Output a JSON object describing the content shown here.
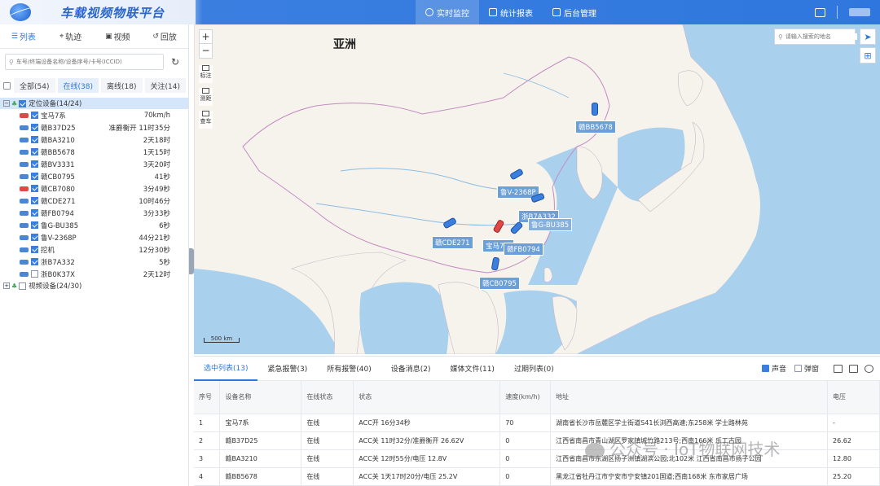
{
  "app": {
    "title": "车载视频物联平台"
  },
  "nav": [
    {
      "label": "实时监控",
      "active": true
    },
    {
      "label": "统计报表",
      "active": false
    },
    {
      "label": "后台管理",
      "active": false
    }
  ],
  "left": {
    "tabs": [
      {
        "icon": "list-icon",
        "label": "列表",
        "active": true
      },
      {
        "icon": "track-icon",
        "label": "轨迹",
        "active": false
      },
      {
        "icon": "video-icon",
        "label": "视频",
        "active": false
      },
      {
        "icon": "playback-icon",
        "label": "回放",
        "active": false
      }
    ],
    "search_placeholder": "车号/终端设备名称/设备序号/卡号(ICCID)",
    "filters": [
      {
        "label": "全部(54)",
        "active": false
      },
      {
        "label": "在线(38)",
        "active": true
      },
      {
        "label": "离线(18)",
        "active": false
      },
      {
        "label": "关注(14)",
        "active": false
      }
    ],
    "group_located": "定位设备(14/24)",
    "group_video": "视频设备(24/30)",
    "vehicles": [
      {
        "plate": "宝马7系",
        "status": "70km/h",
        "red": true,
        "checked": true
      },
      {
        "plate": "赣B37D25",
        "status": "准爵衡开 11时35分",
        "red": false,
        "checked": true
      },
      {
        "plate": "赣BA3210",
        "status": "2天18时",
        "red": false,
        "checked": true
      },
      {
        "plate": "赣BB5678",
        "status": "1天15时",
        "red": false,
        "checked": true
      },
      {
        "plate": "赣BV3331",
        "status": "3天20时",
        "red": false,
        "checked": true
      },
      {
        "plate": "赣CB0795",
        "status": "41秒",
        "red": false,
        "checked": true
      },
      {
        "plate": "赣CB7080",
        "status": "3分49秒",
        "red": true,
        "checked": true
      },
      {
        "plate": "赣CDE271",
        "status": "10时46分",
        "red": false,
        "checked": true
      },
      {
        "plate": "赣FB0794",
        "status": "3分33秒",
        "red": false,
        "checked": true
      },
      {
        "plate": "鲁G-BU385",
        "status": "6秒",
        "red": false,
        "checked": true
      },
      {
        "plate": "鲁V-2368P",
        "status": "44分21秒",
        "red": false,
        "checked": true
      },
      {
        "plate": "挖机",
        "status": "12分30秒",
        "red": false,
        "checked": true
      },
      {
        "plate": "浙B7A332",
        "status": "5秒",
        "red": false,
        "checked": true
      },
      {
        "plate": "浙B0K37X",
        "status": "2天12时",
        "red": false,
        "checked": false
      }
    ]
  },
  "map": {
    "search_placeholder": "请输入搜索的地名",
    "continent": "亚洲",
    "scale": "500 km",
    "zoom_in": "+",
    "zoom_out": "−",
    "tools": [
      "标注",
      "测距",
      "查车"
    ],
    "labels": {
      "bb5678": "赣BB5678",
      "lu_v": "鲁V-2368P",
      "zhe_b": "浙B7A332",
      "lu_g": "鲁G-BU385",
      "cde271": "赣CDE271",
      "bmw": "宝马7系",
      "fb0794": "赣FB0794",
      "cb0795": "赣CB0795"
    }
  },
  "bottom": {
    "tabs": [
      {
        "label": "选中列表(13)",
        "active": true
      },
      {
        "label": "紧急报警(3)",
        "active": false
      },
      {
        "label": "所有报警(40)",
        "active": false
      },
      {
        "label": "设备消息(2)",
        "active": false
      },
      {
        "label": "媒体文件(11)",
        "active": false
      },
      {
        "label": "过期列表(0)",
        "active": false
      }
    ],
    "sound_label": "声音",
    "popup_label": "弹窗",
    "columns": [
      "序号",
      "设备名称",
      "在线状态",
      "状态",
      "速度(km/h)",
      "地址",
      "电压"
    ],
    "rows": [
      [
        "1",
        "宝马7系",
        "在线",
        "ACC开 16分34秒",
        "70",
        "湖南省长沙市岳麓区学士街道S41长浏西高速;东258米 学士路林苑",
        "-"
      ],
      [
        "2",
        "赣B37D25",
        "在线",
        "ACC关 11时32分/准爵衡开 26.62V",
        "0",
        "江西省南昌市青山湖区罗家镇城竹路213号;西南166米 乐工古园",
        "26.62"
      ],
      [
        "3",
        "赣BA3210",
        "在线",
        "ACC关 12时55分/电压 12.8V",
        "0",
        "江西省南昌市东湖区扬子洲镇湖滨公园;北102米 江西省南昌市扬子公园",
        "12.80"
      ],
      [
        "4",
        "赣BB5678",
        "在线",
        "ACC关 1天17时20分/电压 25.2V",
        "0",
        "黑龙江省牡丹江市宁安市宁安镇201国道;西南168米 东市家居广场",
        "25.20"
      ]
    ]
  },
  "watermark": "公众号 · IoT物联网技术"
}
